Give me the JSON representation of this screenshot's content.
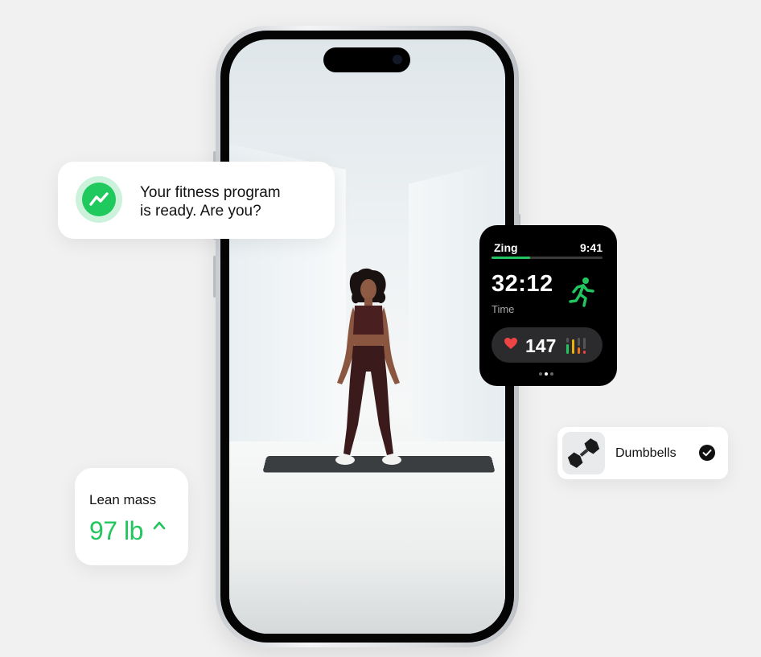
{
  "notification": {
    "line1": "Your fitness program",
    "line2": "is ready. Are you?",
    "icon": "trend-up-icon"
  },
  "watch": {
    "app_name": "Zing",
    "clock": "9:41",
    "workout_progress": 0.35,
    "elapsed": "32:12",
    "elapsed_label": "Time",
    "heart_rate": "147",
    "page_index": 1,
    "page_count": 3,
    "icons": [
      "running-icon",
      "heart-icon",
      "heart-rate-zones-icon"
    ]
  },
  "equipment": {
    "label": "Dumbbells",
    "checked": true,
    "icon": "dumbbell-icon"
  },
  "stats": {
    "label": "Lean mass",
    "value": "97 lb",
    "trend": "up"
  },
  "colors": {
    "accent_green": "#22c55e",
    "heart_red": "#ef4444",
    "background": "#f1f1f1"
  }
}
